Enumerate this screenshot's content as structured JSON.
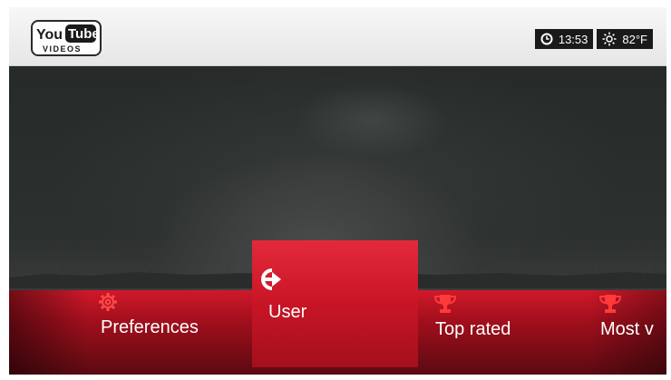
{
  "app": {
    "logo_top": "You",
    "logo_badge": "Tube",
    "logo_sub": "VIDEOS"
  },
  "status": {
    "clock_icon": "clock-icon",
    "time": "13:53",
    "weather_icon": "sun-icon",
    "temperature": "82°F"
  },
  "menu": {
    "items": [
      {
        "label": "Preferences",
        "icon": "gear-icon",
        "selected": false
      },
      {
        "label": "User",
        "icon": "sign-in-arrow-icon",
        "selected": true
      },
      {
        "label": "Top rated",
        "icon": "trophy-icon",
        "selected": false
      },
      {
        "label": "Most v",
        "icon": "trophy-icon",
        "selected": false
      }
    ]
  },
  "colors": {
    "accent_red": "#c81526",
    "topbar_bg": "#eeeeee",
    "chip_bg": "#1a1a1a"
  }
}
